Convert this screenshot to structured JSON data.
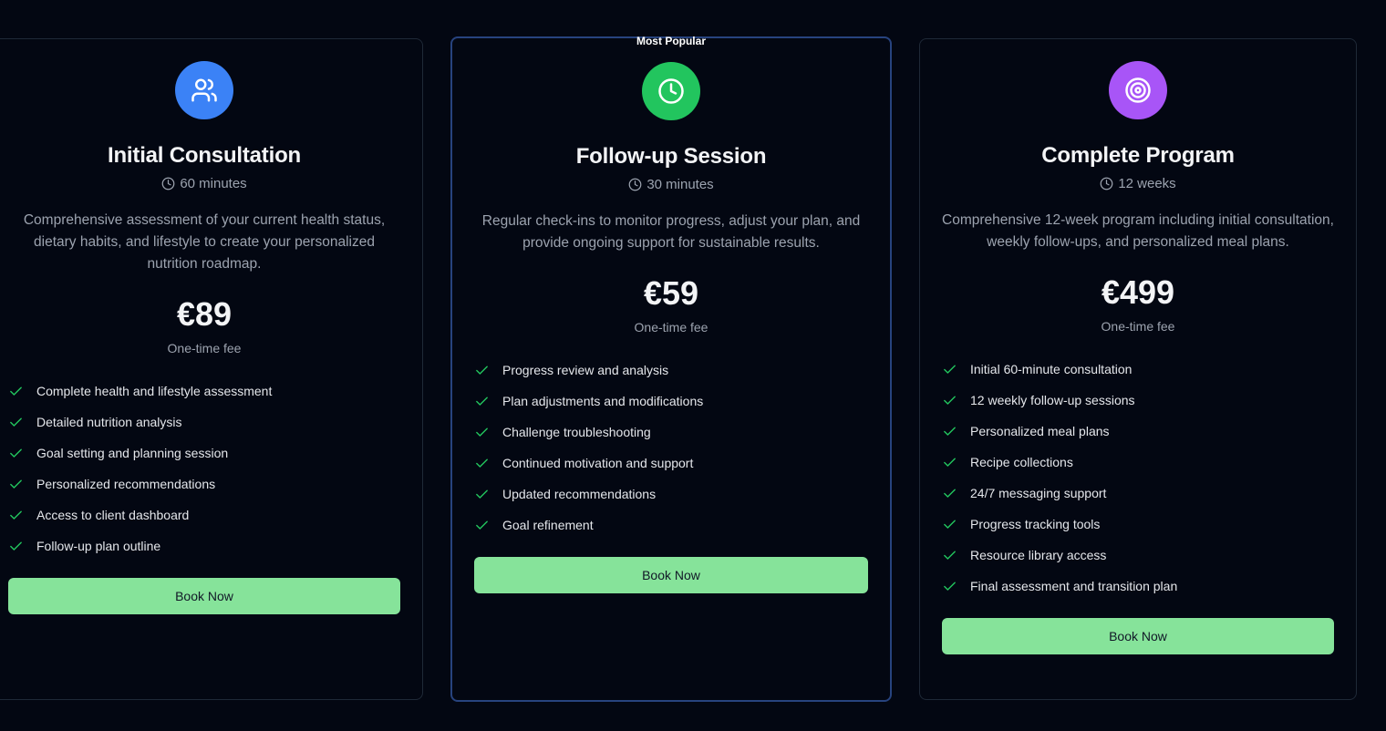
{
  "colors": {
    "background": "#030712",
    "accent_green": "#86e39a",
    "check_green": "#22c55e",
    "icon_blue": "#3b82f6",
    "icon_green": "#22c55e",
    "icon_purple": "#a855f7",
    "featured_border": "#27437e"
  },
  "plans": [
    {
      "icon": "users-icon",
      "title": "Initial Consultation",
      "duration": "60 minutes",
      "description": "Comprehensive assessment of your current health status, dietary habits, and lifestyle to create your personalized nutrition roadmap.",
      "price": "€89",
      "fee_note": "One-time fee",
      "features": [
        "Complete health and lifestyle assessment",
        "Detailed nutrition analysis",
        "Goal setting and planning session",
        "Personalized recommendations",
        "Access to client dashboard",
        "Follow-up plan outline"
      ],
      "button_label": "Book Now"
    },
    {
      "badge": "Most Popular",
      "icon": "clock-icon",
      "title": "Follow-up Session",
      "duration": "30 minutes",
      "description": "Regular check-ins to monitor progress, adjust your plan, and provide ongoing support for sustainable results.",
      "price": "€59",
      "fee_note": "One-time fee",
      "features": [
        "Progress review and analysis",
        "Plan adjustments and modifications",
        "Challenge troubleshooting",
        "Continued motivation and support",
        "Updated recommendations",
        "Goal refinement"
      ],
      "button_label": "Book Now"
    },
    {
      "icon": "target-icon",
      "title": "Complete Program",
      "duration": "12 weeks",
      "description": "Comprehensive 12-week program including initial consultation, weekly follow-ups, and personalized meal plans.",
      "price": "€499",
      "fee_note": "One-time fee",
      "features": [
        "Initial 60-minute consultation",
        "12 weekly follow-up sessions",
        "Personalized meal plans",
        "Recipe collections",
        "24/7 messaging support",
        "Progress tracking tools",
        "Resource library access",
        "Final assessment and transition plan"
      ],
      "button_label": "Book Now"
    }
  ]
}
